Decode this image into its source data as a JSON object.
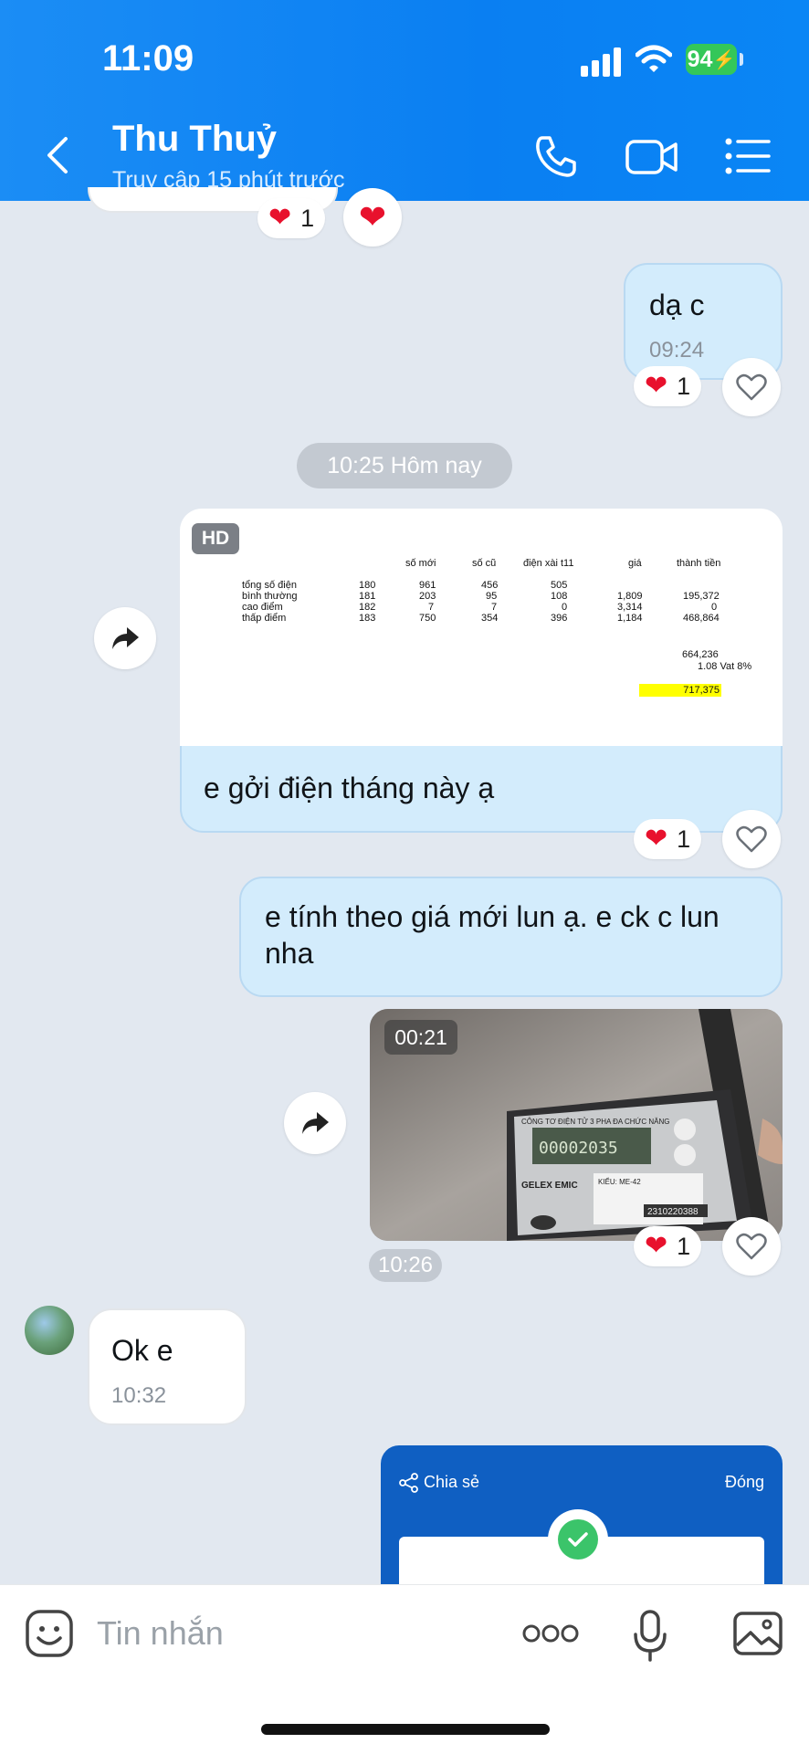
{
  "status_bar": {
    "time": "11:09",
    "battery": "94"
  },
  "header": {
    "name": "Thu Thuỷ",
    "status": "Truy cập 15 phút trước"
  },
  "messages": {
    "top_reaction_count": "1",
    "msg1": {
      "text": "dạ c",
      "time": "09:24",
      "reaction_count": "1"
    },
    "divider": "10:25 Hôm nay",
    "image_msg": {
      "badge": "HD",
      "caption": "e gởi điện tháng này ạ",
      "reaction_count": "1",
      "sheet": {
        "headers": [
          "số mới",
          "số cũ",
          "điện xài t11",
          "giá",
          "thành tiền"
        ],
        "rows": [
          {
            "label": "tổng số điện",
            "n": "180",
            "moi": "961",
            "cu": "456",
            "xai": "505",
            "gia": "",
            "tien": ""
          },
          {
            "label": "bình thường",
            "n": "181",
            "moi": "203",
            "cu": "95",
            "xai": "108",
            "gia": "1,809",
            "tien": "195,372"
          },
          {
            "label": "cao điểm",
            "n": "182",
            "moi": "7",
            "cu": "7",
            "xai": "0",
            "gia": "3,314",
            "tien": "0"
          },
          {
            "label": "thấp điểm",
            "n": "183",
            "moi": "750",
            "cu": "354",
            "xai": "396",
            "gia": "1,184",
            "tien": "468,864"
          }
        ],
        "subtotal": "664,236",
        "vat": "1.08 Vat 8%",
        "total": "717,375"
      }
    },
    "msg2": {
      "text": "e tính theo giá mới lun ạ. e ck c lun nha"
    },
    "video_msg": {
      "duration": "00:21",
      "time": "10:26",
      "reaction_count": "1",
      "meter": {
        "brand_text": "CÔNG TƠ ĐIỆN TỬ 3 PHA ĐA CHỨC NĂNG",
        "reading": "00002035",
        "maker": "GELEX EMIC",
        "model": "KIỂU: ME-42",
        "serial": "2310220388"
      }
    },
    "msg3": {
      "text": "Ok e",
      "time": "10:32"
    },
    "share_card": {
      "share": "Chia sẻ",
      "close": "Đóng"
    }
  },
  "input": {
    "placeholder": "Tin nhắn"
  },
  "colors": {
    "header_blue": "#0a7ff2",
    "bubble_me": "#d3ecfc",
    "heart": "#e8112d",
    "highlight": "#ffff00"
  }
}
